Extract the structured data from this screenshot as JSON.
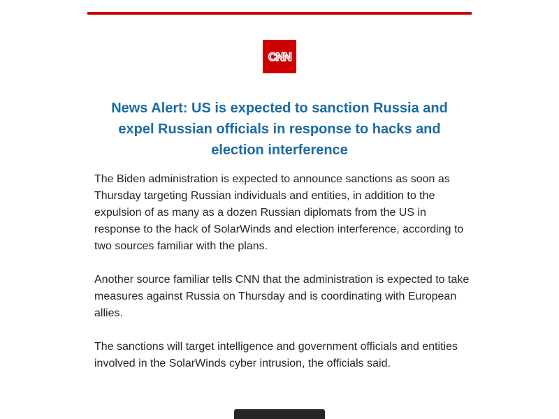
{
  "colors": {
    "brand_red": "#cc0000",
    "headline_blue": "#1b6aa5",
    "body_text": "#262626",
    "button_bg": "#262626"
  },
  "logo": {
    "icon": "cnn-logo-icon",
    "text": "CNN"
  },
  "alert": {
    "headline": "News Alert: US is expected to sanction Russia and expel Russian officials in response to hacks and election interference",
    "paragraphs": [
      "The Biden administration is expected to announce sanctions as soon as Thursday targeting Russian individuals and entities, in addition to the expulsion of as many as a dozen Russian diplomats from the US in response to the hack of SolarWinds and election interference, according to two sources familiar with the plans.",
      "Another source familiar tells CNN that the administration is expected to take measures against Russia on Thursday and is coordinating with European allies.",
      "The sanctions will target intelligence and government officials and entities involved in the SolarWinds cyber intrusion, the officials said."
    ]
  },
  "cta": {
    "label": ""
  }
}
